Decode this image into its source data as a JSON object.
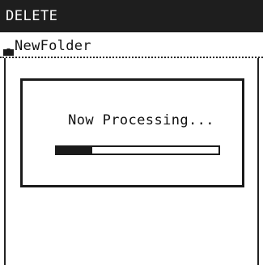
{
  "title_bar": {
    "title": "DELETE"
  },
  "folder_row": {
    "icon": "folder-icon",
    "label": "NewFolder"
  },
  "dialog": {
    "message": "Now Processing...",
    "progress": 0.22
  },
  "colors": {
    "title_bar_bg": "#1e1e1e",
    "title_text": "#ffffff",
    "foreground": "#1a1a1a",
    "background": "#ffffff"
  }
}
